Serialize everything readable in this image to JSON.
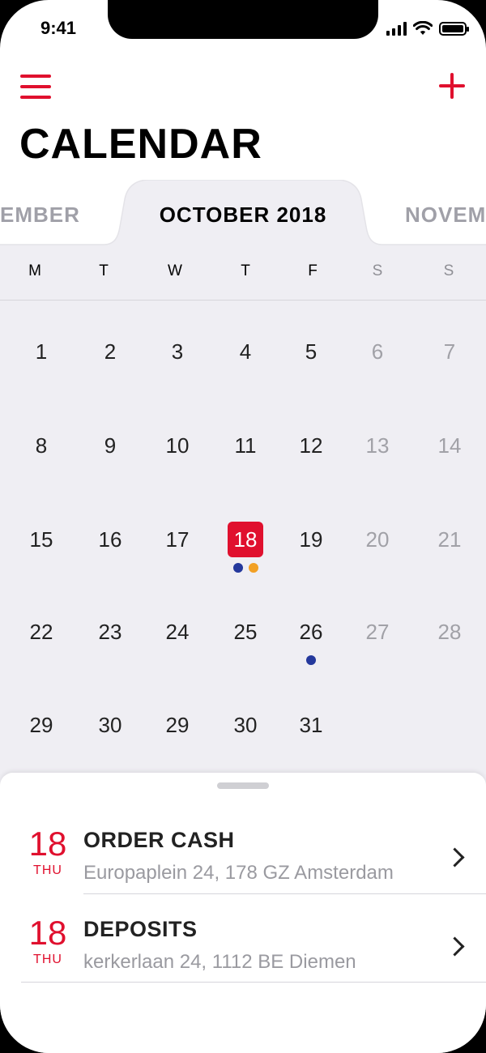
{
  "status_bar": {
    "time": "9:41"
  },
  "header": {
    "title": "CALENDAR",
    "menu_icon": "hamburger-menu-icon",
    "add_icon": "plus-icon"
  },
  "month_nav": {
    "previous": "EMBER",
    "current": "OCTOBER 2018",
    "next": "NOVEM"
  },
  "weekdays": [
    "M",
    "T",
    "W",
    "T",
    "F",
    "S",
    "S"
  ],
  "weeks": [
    [
      "1",
      "2",
      "3",
      "4",
      "5",
      "6",
      "7"
    ],
    [
      "8",
      "9",
      "10",
      "11",
      "12",
      "13",
      "14"
    ],
    [
      "15",
      "16",
      "17",
      "18",
      "19",
      "20",
      "21"
    ],
    [
      "22",
      "23",
      "24",
      "25",
      "26",
      "27",
      "28"
    ],
    [
      "29",
      "30",
      "29",
      "30",
      "31",
      "",
      ""
    ]
  ],
  "selected_day": "18",
  "event_dots": [
    {
      "day": "18",
      "colors": [
        "#24389c",
        "#f2a024"
      ]
    },
    {
      "day": "26",
      "colors": [
        "#24389c"
      ]
    }
  ],
  "events": [
    {
      "day": "18",
      "weekday": "THU",
      "title": "ORDER CASH",
      "address": "Europaplein 24, 178 GZ Amsterdam"
    },
    {
      "day": "18",
      "weekday": "THU",
      "title": "DEPOSITS",
      "address": "kerkerlaan 24, 1112 BE Diemen"
    }
  ],
  "colors": {
    "accent": "#e0102e",
    "calendar_bg": "#efeef3",
    "muted_text": "#a1a1a7",
    "dot_blue": "#24389c",
    "dot_orange": "#f2a024"
  }
}
